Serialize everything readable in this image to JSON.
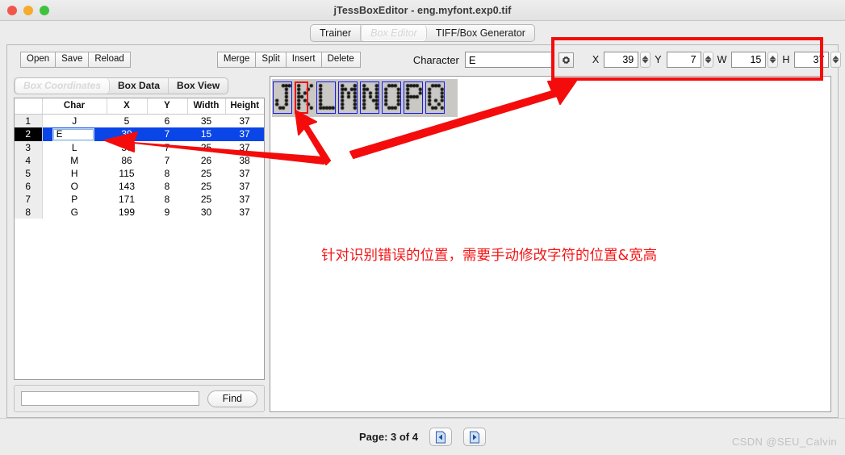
{
  "window": {
    "title": "jTessBoxEditor - eng.myfont.exp0.tif",
    "traffic": {
      "close": "close-button",
      "minimize": "minimize-button",
      "zoom": "zoom-button"
    }
  },
  "tabs": [
    {
      "label": "Trainer",
      "selected": false
    },
    {
      "label": "Box Editor",
      "selected": true
    },
    {
      "label": "TIFF/Box Generator",
      "selected": false
    }
  ],
  "toolbar": {
    "file_buttons": [
      "Open",
      "Save",
      "Reload"
    ],
    "edit_buttons": [
      "Merge",
      "Split",
      "Insert",
      "Delete"
    ],
    "character_label": "Character",
    "character_value": "E",
    "gear_icon": "gear-icon"
  },
  "coords": [
    {
      "label": "X",
      "value": "39"
    },
    {
      "label": "Y",
      "value": "7"
    },
    {
      "label": "W",
      "value": "15"
    },
    {
      "label": "H",
      "value": "37"
    }
  ],
  "subtabs": [
    {
      "label": "Box Coordinates",
      "selected": true
    },
    {
      "label": "Box Data",
      "selected": false
    },
    {
      "label": "Box View",
      "selected": false
    }
  ],
  "table": {
    "columns": [
      "",
      "Char",
      "X",
      "Y",
      "Width",
      "Height"
    ],
    "rows": [
      {
        "num": "1",
        "char": "J",
        "x": "5",
        "y": "6",
        "w": "35",
        "h": "37",
        "selected": false,
        "editing": false
      },
      {
        "num": "2",
        "char": "E",
        "x": "39",
        "y": "7",
        "w": "15",
        "h": "37",
        "selected": true,
        "editing": true
      },
      {
        "num": "3",
        "char": "L",
        "x": "57",
        "y": "7",
        "w": "25",
        "h": "37",
        "selected": false,
        "editing": false
      },
      {
        "num": "4",
        "char": "M",
        "x": "86",
        "y": "7",
        "w": "26",
        "h": "38",
        "selected": false,
        "editing": false
      },
      {
        "num": "5",
        "char": "H",
        "x": "115",
        "y": "8",
        "w": "25",
        "h": "37",
        "selected": false,
        "editing": false
      },
      {
        "num": "6",
        "char": "O",
        "x": "143",
        "y": "8",
        "w": "25",
        "h": "37",
        "selected": false,
        "editing": false
      },
      {
        "num": "7",
        "char": "P",
        "x": "171",
        "y": "8",
        "w": "25",
        "h": "37",
        "selected": false,
        "editing": false
      },
      {
        "num": "8",
        "char": "G",
        "x": "199",
        "y": "9",
        "w": "30",
        "h": "37",
        "selected": false,
        "editing": false
      }
    ]
  },
  "find": {
    "input_value": "",
    "button_label": "Find"
  },
  "image_preview": {
    "glyphs": [
      "J",
      "K",
      "L",
      "M",
      "N",
      "O",
      "P",
      "Q"
    ],
    "selected_index": 1,
    "box_color": "#1818ee",
    "selected_box_color": "#ee1111"
  },
  "annotation": {
    "text": "针对识别错误的位置，需要手动修改字符的位置&宽高",
    "color": "#f41616",
    "arrows": 3,
    "highlight_color": "#f40c0c"
  },
  "footer": {
    "page_label": "Page: 3 of 4",
    "prev_icon": "prev-page-icon",
    "next_icon": "next-page-icon"
  },
  "watermark": "CSDN @SEU_Calvin"
}
